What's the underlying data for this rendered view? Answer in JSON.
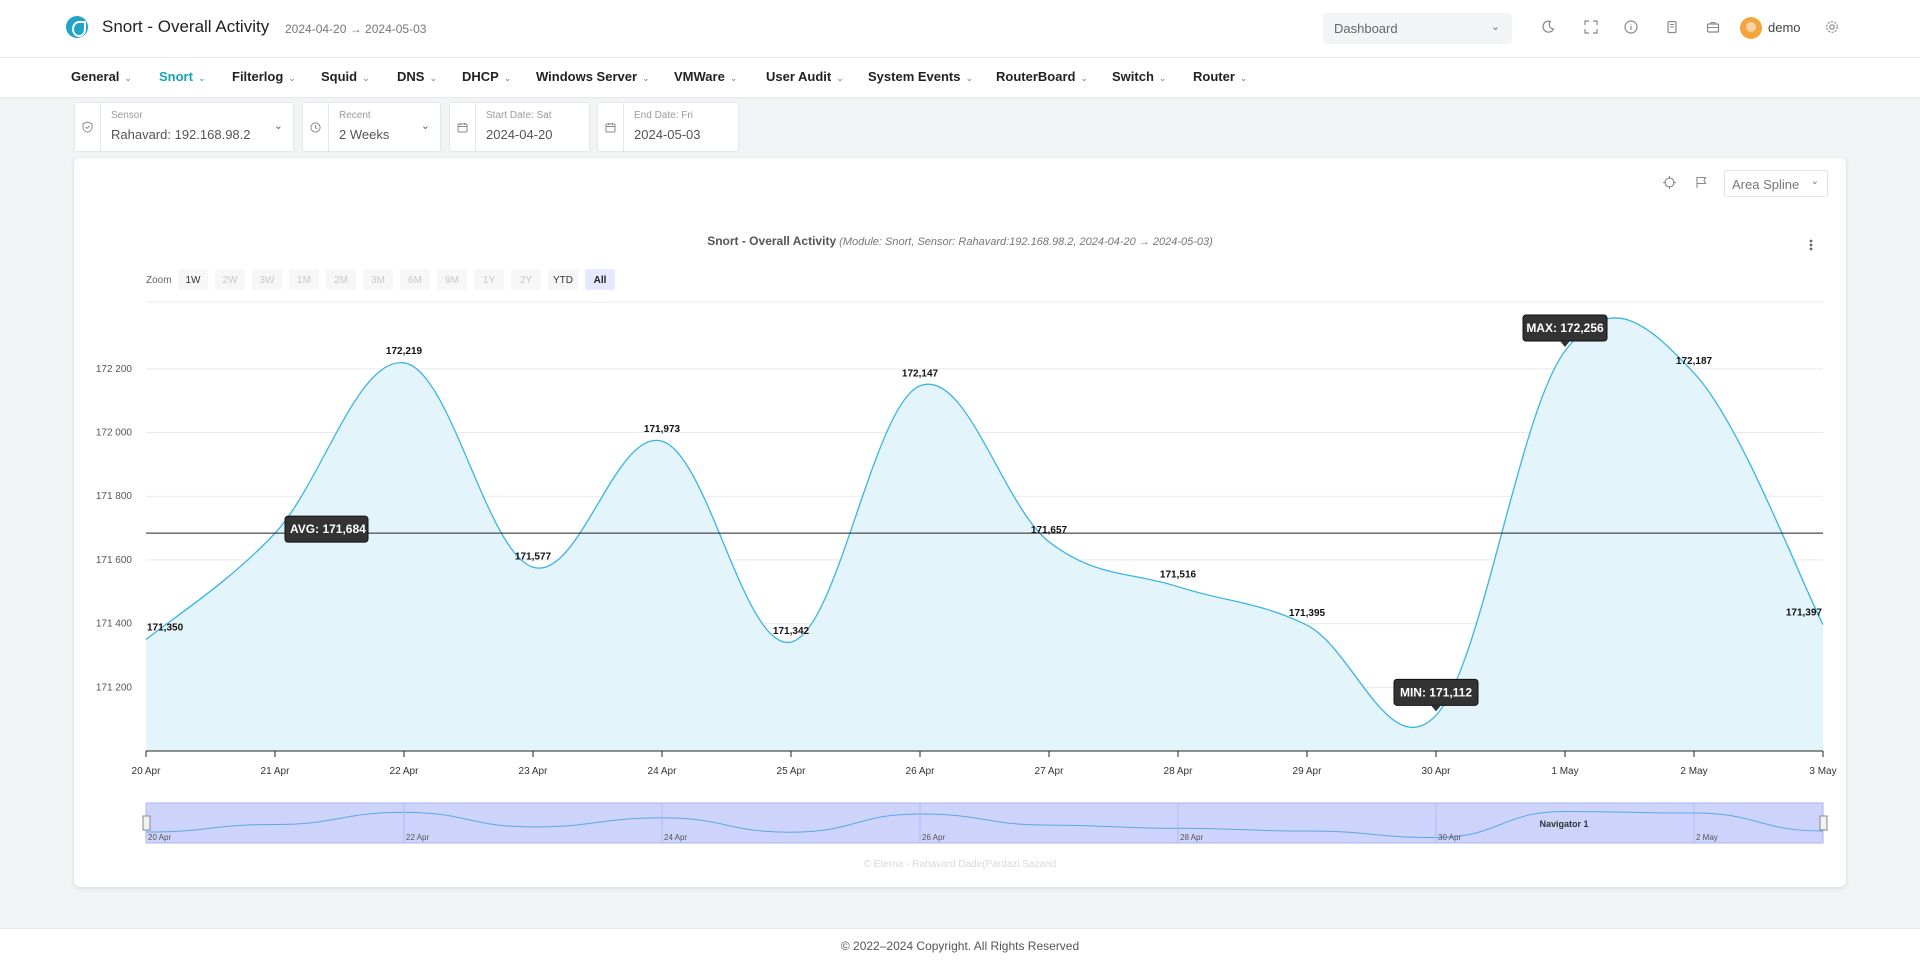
{
  "header": {
    "title": "Snort - Overall Activity",
    "range": "2024-04-20 → 2024-05-03",
    "dashboard_select": "Dashboard",
    "user": "demo"
  },
  "menu": [
    {
      "label": "General"
    },
    {
      "label": "Snort",
      "active": true
    },
    {
      "label": "Filterlog"
    },
    {
      "label": "Squid"
    },
    {
      "label": "DNS"
    },
    {
      "label": "DHCP"
    },
    {
      "label": "Windows Server"
    },
    {
      "label": "VMWare"
    },
    {
      "label": "User Audit"
    },
    {
      "label": "System Events"
    },
    {
      "label": "RouterBoard"
    },
    {
      "label": "Switch"
    },
    {
      "label": "Router"
    }
  ],
  "filters": {
    "sensor": {
      "label": "Sensor",
      "value": "Rahavard: 192.168.98.2"
    },
    "recent": {
      "label": "Recent",
      "value": "2 Weeks"
    },
    "start": {
      "label": "Start Date: Sat",
      "value": "2024-04-20"
    },
    "end": {
      "label": "End Date: Fri",
      "value": "2024-05-03"
    }
  },
  "chart_controls": {
    "type_select": "Area Spline",
    "zoom_label": "Zoom",
    "zoom_buttons": [
      "1W",
      "2W",
      "3W",
      "1M",
      "2M",
      "3M",
      "6M",
      "9M",
      "1Y",
      "2Y",
      "YTD",
      "All"
    ],
    "zoom_enabled": [
      "1W",
      "YTD",
      "All"
    ],
    "zoom_selected": "All"
  },
  "chart_data": {
    "type": "area",
    "title": "Snort - Overall Activity",
    "subtitle": "(Module: Snort, Sensor: Rahavard:192.168.98.2, 2024-04-20 → 2024-05-03)",
    "x": [
      "20 Apr",
      "21 Apr",
      "22 Apr",
      "23 Apr",
      "24 Apr",
      "25 Apr",
      "26 Apr",
      "27 Apr",
      "28 Apr",
      "29 Apr",
      "30 Apr",
      "1 May",
      "2 May",
      "3 May"
    ],
    "series": [
      {
        "values": [
          171350,
          171684,
          172219,
          171577,
          171973,
          171342,
          172147,
          171657,
          171516,
          171395,
          171112,
          172256,
          172187,
          171397
        ]
      }
    ],
    "data_labels": [
      {
        "index": 0,
        "text": "171,350"
      },
      {
        "index": 2,
        "text": "172,219"
      },
      {
        "index": 3,
        "text": "171,577"
      },
      {
        "index": 4,
        "text": "171,973"
      },
      {
        "index": 5,
        "text": "171,342"
      },
      {
        "index": 6,
        "text": "172,147"
      },
      {
        "index": 7,
        "text": "171,657"
      },
      {
        "index": 8,
        "text": "171,516"
      },
      {
        "index": 9,
        "text": "171,395"
      },
      {
        "index": 12,
        "text": "172,187"
      },
      {
        "index": 13,
        "text": "171,397"
      }
    ],
    "yticks": [
      171200,
      171400,
      171600,
      171800,
      172000,
      172200
    ],
    "ytick_labels": [
      "171 200",
      "171 400",
      "171 600",
      "171 800",
      "172 000",
      "172 200"
    ],
    "ylim": [
      171000,
      172410
    ],
    "avg": {
      "value": 171684,
      "label": "AVG: 171,684"
    },
    "max": {
      "index": 11,
      "value": 172256,
      "label": "MAX: 172,256"
    },
    "min": {
      "index": 10,
      "value": 171112,
      "label": "MIN: 171,112"
    },
    "grid": true,
    "legend": "none",
    "line_color": "#3bb4e4",
    "fill_color": "#e3f4fb",
    "navigator": {
      "label": "Navigator 1",
      "ticks": [
        "20 Apr",
        "22 Apr",
        "24 Apr",
        "26 Apr",
        "28 Apr",
        "30 Apr",
        "2 May"
      ]
    },
    "credit": "© Eterna - Rahavard Dade(Pardazi Sazand"
  },
  "footer": {
    "copyright": "© 2022–2024 Copyright. All Rights Reserved"
  }
}
